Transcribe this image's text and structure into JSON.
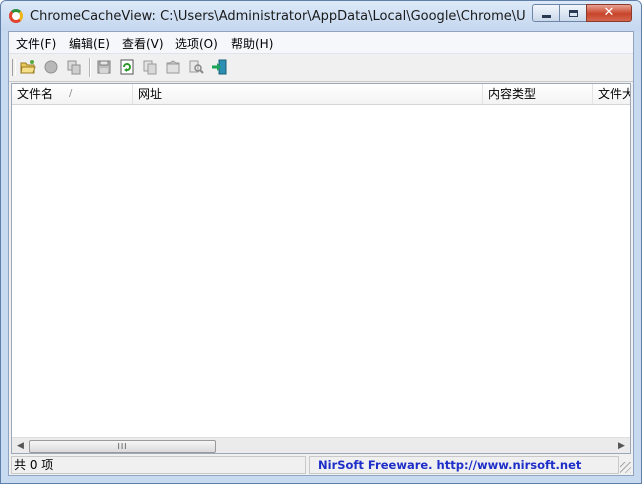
{
  "window": {
    "title": "ChromeCacheView:  C:\\Users\\Administrator\\AppData\\Local\\Google\\Chrome\\User D..."
  },
  "menu": [
    {
      "label": "文件(F)"
    },
    {
      "label": "编辑(E)"
    },
    {
      "label": "查看(V)"
    },
    {
      "label": "选项(O)"
    },
    {
      "label": "帮助(H)"
    }
  ],
  "toolbar": [
    {
      "icon": "open-folder-icon"
    },
    {
      "icon": "stop-icon"
    },
    {
      "icon": "copy-files-icon"
    },
    {
      "icon": "save-icon"
    },
    {
      "icon": "refresh-icon"
    },
    {
      "icon": "copy-icon"
    },
    {
      "icon": "properties-icon"
    },
    {
      "icon": "find-icon"
    },
    {
      "icon": "exit-icon"
    }
  ],
  "columns": [
    {
      "label": "文件名"
    },
    {
      "label": "网址"
    },
    {
      "label": "内容类型"
    },
    {
      "label": "文件大"
    }
  ],
  "status": {
    "count": "共 0 项",
    "credit": "NirSoft Freeware.  http://www.nirsoft.net"
  },
  "scrollbar": {
    "thumb_grip": "III"
  }
}
